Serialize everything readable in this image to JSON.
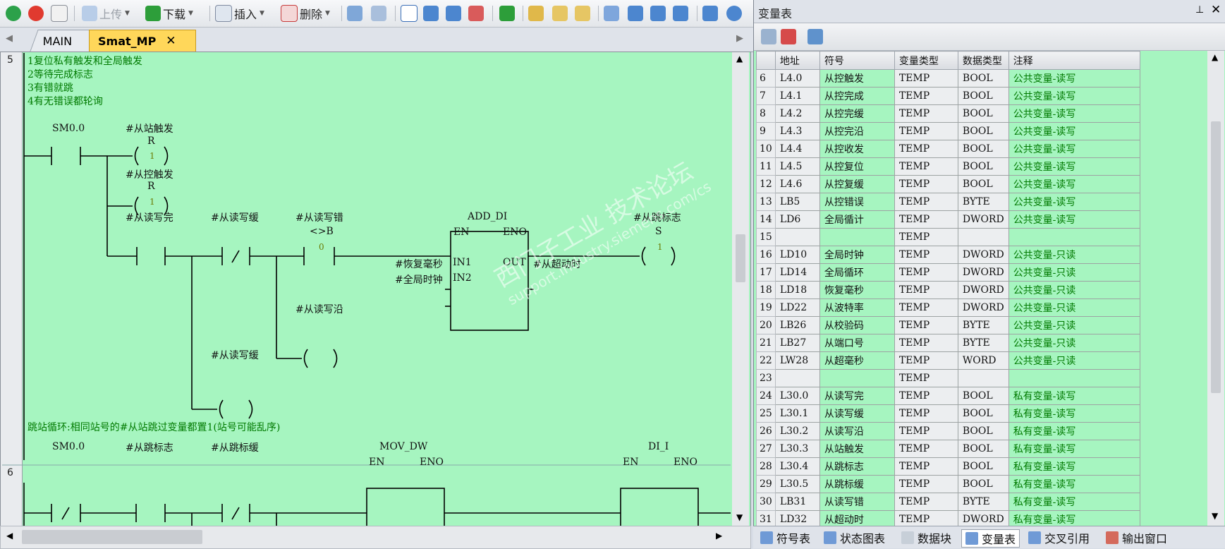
{
  "toolbar": {
    "upload_label": "上传",
    "download_label": "下载",
    "insert_label": "插入",
    "delete_label": "删除"
  },
  "tabs": [
    {
      "label": "MAIN"
    },
    {
      "label": "Smat_MP"
    }
  ],
  "network5": {
    "number": "5",
    "comments": [
      "1复位私有触发和全局触发",
      "2等待完成标志",
      "3有错就跳",
      "4有无错误都轮询"
    ],
    "contact1": "SM0.0",
    "coil1": "#从站触发",
    "coil1_letter": "R",
    "coil1_val": "1",
    "coil2": "#从控触发",
    "coil2_letter": "R",
    "coil2_val": "1",
    "contact2": "#从读写完",
    "contact3": "#从读写缓",
    "contact3_letter": "/",
    "compare": "#从读写错",
    "compare_op": "<>B",
    "compare_val": "0",
    "block_title": "ADD_DI",
    "en": "EN",
    "eno": "ENO",
    "in1_name": "#恢复毫秒",
    "in1": "IN1",
    "in2_name": "#全局时钟",
    "in2": "IN2",
    "out": "OUT",
    "out_name": "#从超动时",
    "coil3": "#从跳标志",
    "coil3_letter": "S",
    "coil3_val": "1",
    "coil4": "#从读写沿",
    "coil5": "#从读写缓"
  },
  "network6": {
    "number": "6",
    "comment": "跳站循环:相同站号的#从站跳过变量都置1(站号可能乱序)",
    "contact1": "SM0.0",
    "contact1_letter": "/",
    "contact2": "#从跳标志",
    "contact3": "#从跳标缓",
    "contact3_letter": "/",
    "block1": "MOV_DW",
    "block2": "DI_I",
    "en": "EN",
    "eno": "ENO"
  },
  "watermark": {
    "line1": "西门子工业  技术论坛",
    "line2": "support.industry.siemens.com/cs"
  },
  "panel": {
    "title": "变量表",
    "columns": [
      "地址",
      "符号",
      "变量类型",
      "数据类型",
      "注释"
    ],
    "rows": [
      [
        "6",
        "L4.0",
        "从控触发",
        "TEMP",
        "BOOL",
        "公共变量-读写"
      ],
      [
        "7",
        "L4.1",
        "从控完成",
        "TEMP",
        "BOOL",
        "公共变量-读写"
      ],
      [
        "8",
        "L4.2",
        "从控完缓",
        "TEMP",
        "BOOL",
        "公共变量-读写"
      ],
      [
        "9",
        "L4.3",
        "从控完沿",
        "TEMP",
        "BOOL",
        "公共变量-读写"
      ],
      [
        "10",
        "L4.4",
        "从控收发",
        "TEMP",
        "BOOL",
        "公共变量-读写"
      ],
      [
        "11",
        "L4.5",
        "从控复位",
        "TEMP",
        "BOOL",
        "公共变量-读写"
      ],
      [
        "12",
        "L4.6",
        "从控复缓",
        "TEMP",
        "BOOL",
        "公共变量-读写"
      ],
      [
        "13",
        "LB5",
        "从控错误",
        "TEMP",
        "BYTE",
        "公共变量-读写"
      ],
      [
        "14",
        "LD6",
        "全局循计",
        "TEMP",
        "DWORD",
        "公共变量-读写"
      ],
      [
        "15",
        "",
        "",
        "TEMP",
        "",
        ""
      ],
      [
        "16",
        "LD10",
        "全局时钟",
        "TEMP",
        "DWORD",
        "公共变量-只读"
      ],
      [
        "17",
        "LD14",
        "全局循环",
        "TEMP",
        "DWORD",
        "公共变量-只读"
      ],
      [
        "18",
        "LD18",
        "恢复毫秒",
        "TEMP",
        "DWORD",
        "公共变量-只读"
      ],
      [
        "19",
        "LD22",
        "从波特率",
        "TEMP",
        "DWORD",
        "公共变量-只读"
      ],
      [
        "20",
        "LB26",
        "从校验码",
        "TEMP",
        "BYTE",
        "公共变量-只读"
      ],
      [
        "21",
        "LB27",
        "从端口号",
        "TEMP",
        "BYTE",
        "公共变量-只读"
      ],
      [
        "22",
        "LW28",
        "从超毫秒",
        "TEMP",
        "WORD",
        "公共变量-只读"
      ],
      [
        "23",
        "",
        "",
        "TEMP",
        "",
        ""
      ],
      [
        "24",
        "L30.0",
        "从读写完",
        "TEMP",
        "BOOL",
        "私有变量-读写"
      ],
      [
        "25",
        "L30.1",
        "从读写缓",
        "TEMP",
        "BOOL",
        "私有变量-读写"
      ],
      [
        "26",
        "L30.2",
        "从读写沿",
        "TEMP",
        "BOOL",
        "私有变量-读写"
      ],
      [
        "27",
        "L30.3",
        "从站触发",
        "TEMP",
        "BOOL",
        "私有变量-读写"
      ],
      [
        "28",
        "L30.4",
        "从跳标志",
        "TEMP",
        "BOOL",
        "私有变量-读写"
      ],
      [
        "29",
        "L30.5",
        "从跳标缓",
        "TEMP",
        "BOOL",
        "私有变量-读写"
      ],
      [
        "30",
        "LB31",
        "从读写错",
        "TEMP",
        "BYTE",
        "私有变量-读写"
      ],
      [
        "31",
        "LD32",
        "从超动时",
        "TEMP",
        "DWORD",
        "私有变量-读写"
      ]
    ]
  },
  "bottom_tabs": [
    {
      "label": "符号表"
    },
    {
      "label": "状态图表"
    },
    {
      "label": "数据块"
    },
    {
      "label": "变量表"
    },
    {
      "label": "交叉引用"
    },
    {
      "label": "输出窗口"
    }
  ],
  "colors": {
    "ladder_bg": "#a6f5c0",
    "comment": "#007a00"
  }
}
